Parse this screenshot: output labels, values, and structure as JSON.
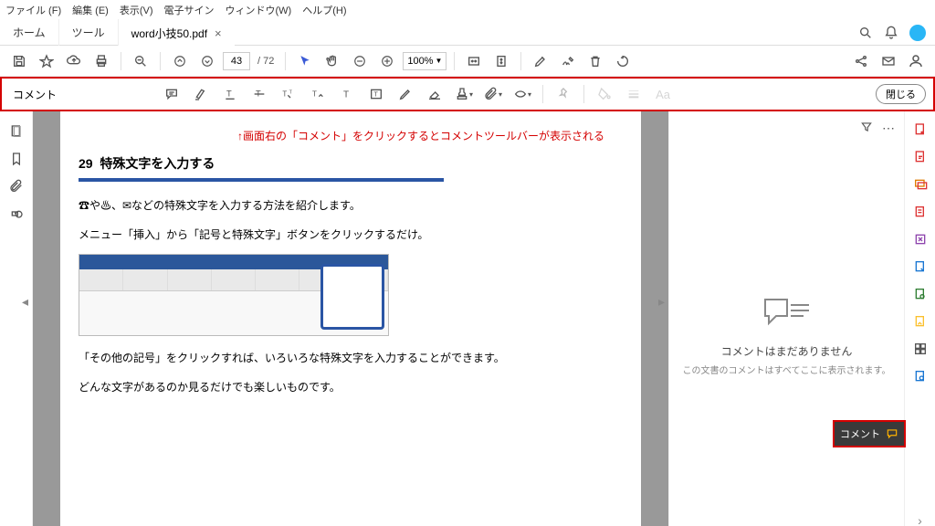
{
  "menu": {
    "file": "ファイル (F)",
    "edit": "編集 (E)",
    "view": "表示(V)",
    "esign": "電子サイン",
    "window": "ウィンドウ(W)",
    "help": "ヘルプ(H)"
  },
  "tabs": {
    "home": "ホーム",
    "tools": "ツール",
    "doc": "word小技50.pdf"
  },
  "toolbar": {
    "page_current": "43",
    "page_total": "/ 72",
    "zoom": "100%"
  },
  "comment_bar": {
    "label": "コメント",
    "close": "閉じる"
  },
  "hint": "↑画面右の「コメント」をクリックするとコメントツールバーが表示される",
  "doc": {
    "title_num": "29",
    "title_text": "特殊文字を入力する",
    "para1": "☎や♨、✉などの特殊文字を入力する方法を紹介します。",
    "para2": "メニュー「挿入」から「記号と特殊文字」ボタンをクリックするだけ。",
    "para3": "「その他の記号」をクリックすれば、いろいろな特殊文字を入力することができます。",
    "para4": "どんな文字があるのか見るだけでも楽しいものです。"
  },
  "comment_panel": {
    "empty_title": "コメントはまだありません",
    "empty_sub": "この文書のコメントはすべてここに表示されます。",
    "float_label": "コメント"
  }
}
